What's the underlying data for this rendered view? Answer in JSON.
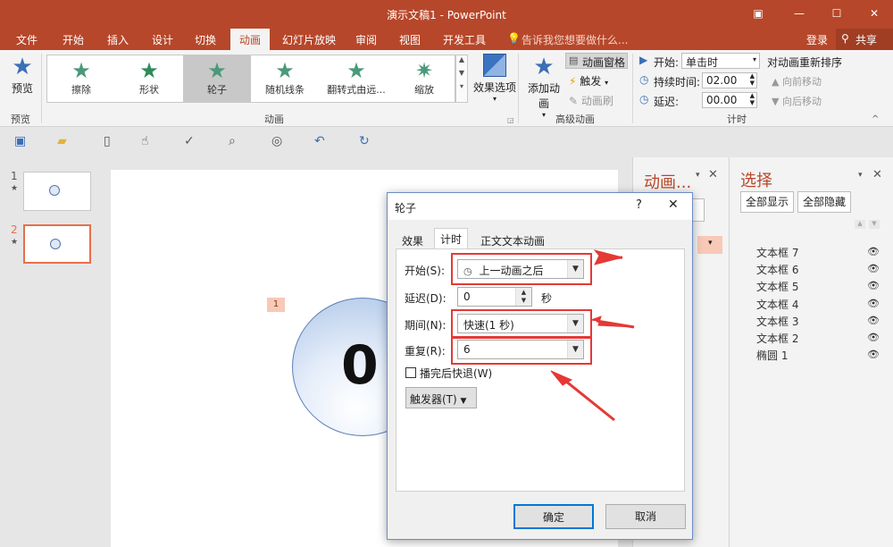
{
  "window": {
    "title": "演示文稿1 - PowerPoint",
    "buttons": {
      "ribbon_display": "▣",
      "minimize": "—",
      "maximize": "☐",
      "close": "✕"
    }
  },
  "tabs": [
    {
      "label": "文件"
    },
    {
      "label": "开始"
    },
    {
      "label": "插入"
    },
    {
      "label": "设计"
    },
    {
      "label": "切换"
    },
    {
      "label": "动画"
    },
    {
      "label": "幻灯片放映"
    },
    {
      "label": "审阅"
    },
    {
      "label": "视图"
    },
    {
      "label": "开发工具"
    }
  ],
  "tell_me": "告诉我您想要做什么...",
  "login": "登录",
  "share": "共享",
  "ribbon": {
    "preview": {
      "label": "预览",
      "group": "预览"
    },
    "gallery": [
      {
        "label": "擦除",
        "icon": "★"
      },
      {
        "label": "形状",
        "icon": "★"
      },
      {
        "label": "轮子",
        "icon": "★"
      },
      {
        "label": "随机线条",
        "icon": "★"
      },
      {
        "label": "翻转式由远...",
        "icon": "★"
      },
      {
        "label": "缩放",
        "icon": "✷"
      }
    ],
    "effect_options": "效果选项",
    "animation_group": "动画",
    "add_animation": "添加动画",
    "animation_pane": "动画窗格",
    "trigger": "触发",
    "animation_painter": "动画刷",
    "advanced_group": "高级动画",
    "start_label": "开始:",
    "start_value": "单击时",
    "duration_label": "持续时间:",
    "duration_value": "02.00",
    "delay_label": "延迟:",
    "delay_value": "00.00",
    "timing_group": "计时",
    "reorder": "对动画重新排序",
    "move_earlier": "向前移动",
    "move_later": "向后移动"
  },
  "thumbs": [
    {
      "num": "1"
    },
    {
      "num": "2"
    }
  ],
  "canvas": {
    "tag": "1",
    "digits": "0"
  },
  "anim_pane": {
    "title": "动画..."
  },
  "selection_pane": {
    "title": "选择",
    "show_all": "全部显示",
    "hide_all": "全部隐藏",
    "items": [
      {
        "label": "文本框 7"
      },
      {
        "label": "文本框 6"
      },
      {
        "label": "文本框 5"
      },
      {
        "label": "文本框 4"
      },
      {
        "label": "文本框 3"
      },
      {
        "label": "文本框 2"
      },
      {
        "label": "椭圆 1"
      }
    ]
  },
  "dialog": {
    "title": "轮子",
    "help": "?",
    "tabs": [
      {
        "label": "效果"
      },
      {
        "label": "计时"
      },
      {
        "label": "正文文本动画"
      }
    ],
    "start_label": "开始(S):",
    "start_value": "上一动画之后",
    "delay_label": "延迟(D):",
    "delay_value": "0",
    "delay_unit": "秒",
    "duration_label": "期间(N):",
    "duration_value": "快速(1 秒)",
    "repeat_label": "重复(R):",
    "repeat_value": "6",
    "rewind_label": "播完后快退(W)",
    "trigger_label": "触发器(T)",
    "ok": "确定",
    "cancel": "取消"
  },
  "colors": {
    "accent": "#b7472a",
    "highlight": "#e53935",
    "selected_border": "#0078d7"
  }
}
